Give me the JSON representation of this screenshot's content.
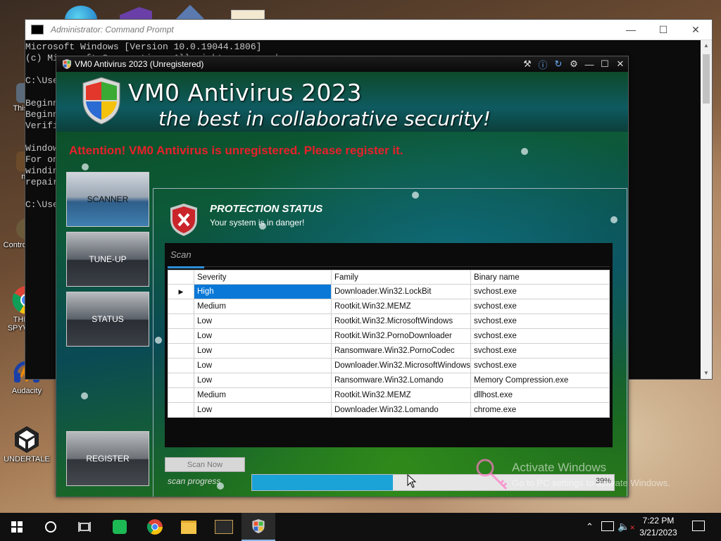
{
  "desktop": {
    "icons": [
      {
        "label": "This PC"
      },
      {
        "label": "mo"
      },
      {
        "label": "Control Panel"
      },
      {
        "label": "THIS IS SPYWARE"
      },
      {
        "label": "Audacity"
      },
      {
        "label": "UNDERTALE"
      }
    ]
  },
  "cmd": {
    "title": "Administrator: Command Prompt",
    "lines": [
      "Microsoft Windows [Version 10.0.19044.1806]",
      "(c) Microsoft Corporation. All rights reserved.",
      "",
      "C:\\Use",
      "",
      "Beginn",
      "Beginn",
      "Verifi",
      "",
      "Window",
      "For on",
      "windin",
      "repair",
      "",
      "C:\\Use"
    ]
  },
  "av": {
    "window_title": "VM0 Antivirus 2023 (Unregistered)",
    "title": "VM0 Antivirus 2023",
    "subtitle": "the best in collaborative security!",
    "attention": "Attention! VM0 Antivirus is unregistered. Please register it.",
    "nav": {
      "scanner": "SCANNER",
      "tuneup": "TUNE-UP",
      "status": "STATUS",
      "register": "REGISTER"
    },
    "protection": {
      "title": "PROTECTION STATUS",
      "subtitle": "Your system is in danger!"
    },
    "scan_tab": "Scan",
    "columns": [
      "Severity",
      "Family",
      "Binary name"
    ],
    "rows": [
      {
        "severity": "High",
        "family": "Downloader.Win32.LockBit",
        "binary": "svchost.exe"
      },
      {
        "severity": "Medium",
        "family": "Rootkit.Win32.MEMZ",
        "binary": "svchost.exe"
      },
      {
        "severity": "Low",
        "family": "Rootkit.Win32.MicrosoftWindows",
        "binary": "svchost.exe"
      },
      {
        "severity": "Low",
        "family": "Rootkit.Win32.PornoDownloader",
        "binary": "svchost.exe"
      },
      {
        "severity": "Low",
        "family": "Ransomware.Win32.PornoCodec",
        "binary": "svchost.exe"
      },
      {
        "severity": "Low",
        "family": "Downloader.Win32.MicrosoftWindows",
        "binary": "svchost.exe"
      },
      {
        "severity": "Low",
        "family": "Ransomware.Win32.Lomando",
        "binary": "Memory Compression.exe"
      },
      {
        "severity": "Medium",
        "family": "Rootkit.Win32.MEMZ",
        "binary": "dllhost.exe"
      },
      {
        "severity": "Low",
        "family": "Downloader.Win32.Lomando",
        "binary": "chrome.exe"
      }
    ],
    "scan_button": "Scan Now",
    "progress_label": "scan progress",
    "progress_value": 39,
    "progress_text": "39%"
  },
  "watermark": {
    "line1": "Activate Windows",
    "line2": "Go to PC settings to activate Windows."
  },
  "taskbar": {
    "time": "7:22 PM",
    "date": "3/21/2023"
  },
  "colors": {
    "attention": "#e8202a",
    "selection": "#0a78d7",
    "progress": "#1ba3d8"
  }
}
